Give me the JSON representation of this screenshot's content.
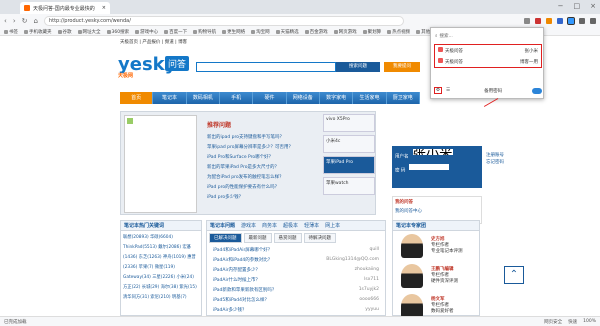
{
  "browser": {
    "tab_title": "天极问答-国内最专业最快的",
    "url": "http://product.yesky.com/wenda/",
    "bookmarks": [
      "书签",
      "手机收藏夹",
      "谷歌",
      "网址大全",
      "360搜索",
      "游戏中心",
      "百度一下",
      "购物导航",
      "更生网络",
      "淘宝网",
      "天猫精选",
      "百金游戏",
      "网页游戏",
      "聚划算",
      "热点视频",
      "其他收藏"
    ]
  },
  "page": {
    "top_links": "天极首页 | 产品报价 | 频道 | 博客",
    "logo_text": "yesky",
    "logo_sub": "天极网",
    "logo_tag": "问答",
    "search_btn": "搜索问题",
    "ask_btn": "我要提问",
    "nav": [
      "首页",
      "笔记本",
      "数码相机",
      "手机",
      "硬件",
      "网络设备",
      "数字家电",
      "生活家电",
      "厨卫家电"
    ],
    "slider_title": "推荐问题",
    "slider_items": [
      "新出的ipad pro支持键盘和手写笔吗？",
      "苹果ipad pro屏幕分辨率是多少？可否用？",
      "iPad Pro和Surface Pro哪个好？",
      "新出的苹果iPad Pro是多大尺寸的？",
      "为配合iPad pro发布的触控笔怎么样？",
      "iPad pro的性能保护要去有什么吗？",
      "iPad pro多少钱？"
    ],
    "slider_right": [
      "vivo X5Pro",
      "小米4c",
      "苹果iPad Pro",
      "苹果watch"
    ],
    "login": {
      "label_user": "用户名",
      "label_pass": "密 码",
      "value": "张小米",
      "links": [
        "注册账号",
        "忘记密码"
      ]
    },
    "cool_title": "我的问答",
    "cool_link": "我的问答中心",
    "left_box_title": "笔记本热门关键词",
    "tags": [
      "联想(20893)",
      "华硕(6604)",
      "ThinkPad(5513)",
      "戴尔(2086)",
      "宏碁(1436)",
      "东芝(1263)",
      "神舟(1019)",
      "惠普(2336)",
      "苹果(7)",
      "微星(119)",
      "Gateway(34)",
      "三星(2226)",
      "小米(24)",
      "方正(22)",
      "长城(29)",
      "海尔(38)",
      "紫光(15)",
      "清华同方(31)",
      "索尼(210)",
      "明基(7)"
    ],
    "mid_box_title": "笔记本问题",
    "mid_box_links": [
      "游戏本",
      "商务本",
      "超极本",
      "轻薄本",
      "网上本"
    ],
    "qtabs": [
      "已解决问题",
      "最新问题",
      "悬赏问题",
      "待解决问题"
    ],
    "questions": [
      {
        "q": "iPad4和iPadAir屏幕哪个好？",
        "u": "quill"
      },
      {
        "q": "iPadAir和iPad4的参数对比？",
        "u": "BLGking1314@QQ.com"
      },
      {
        "q": "iPadAir内存配置多少？",
        "u": "zhoukaiing"
      },
      {
        "q": "iPadAir什么时候上市？",
        "u": "lsx711"
      },
      {
        "q": "iPad新款和苹果新款有区别吗？",
        "u": "1s7uyjk2"
      },
      {
        "q": "iPad5和iPad4对比怎么样？",
        "u": "oooo666"
      },
      {
        "q": "iPadAir多少钱？",
        "u": "yyyuu"
      }
    ],
    "right_box_title": "笔记本专家团",
    "experts": [
      {
        "name": "史方旭",
        "role": "专栏作者",
        "desc": "专业笔记本评测"
      },
      {
        "name": "王鹏飞编辑",
        "role": "专栏作者",
        "desc": "硬件资深评测"
      },
      {
        "name": "杨文军",
        "role": "专栏作者",
        "desc": "数码爱好者"
      }
    ]
  },
  "popup": {
    "search_placeholder": "搜索...",
    "items": [
      {
        "name": "天极问答",
        "user": "张小米"
      },
      {
        "name": "天极问答",
        "user": "博客一用"
      }
    ],
    "footer_label": "备用密码",
    "highlight_color": "#e02020"
  },
  "statusbar": {
    "left": "已完成加载",
    "right": [
      "网页安全",
      "快速",
      "100%"
    ]
  },
  "colors": {
    "accent": "#1478c8",
    "orange": "#f08a00",
    "navy": "#1a5a9a"
  }
}
